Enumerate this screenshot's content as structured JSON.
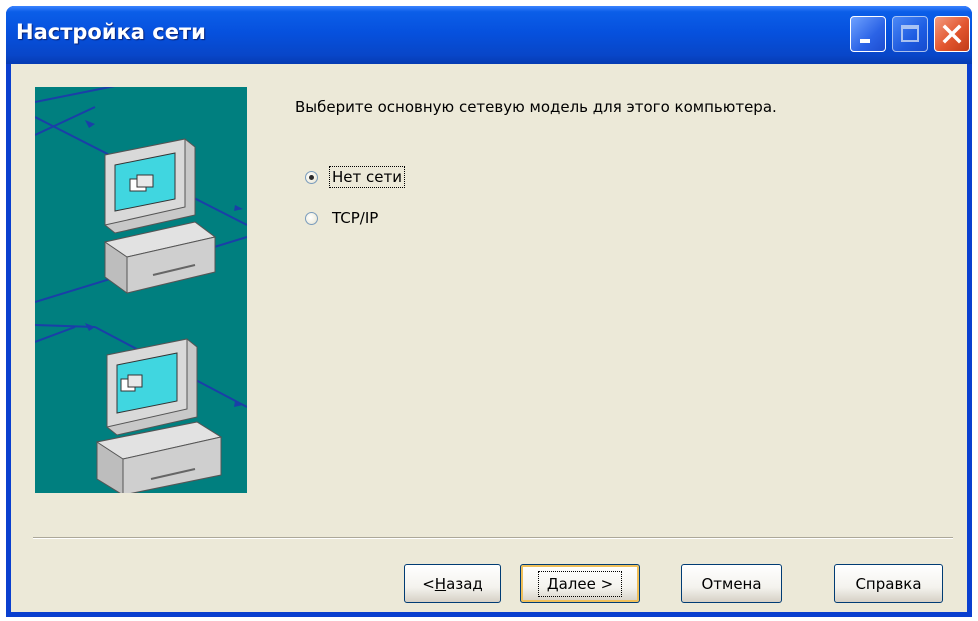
{
  "window": {
    "title": "Настройка сети",
    "colors": {
      "titlebar": "#0651de",
      "client": "#ece9d8",
      "image_bg": "#007f7f"
    }
  },
  "titlebar_buttons": {
    "minimize_icon": "minimize-icon",
    "maximize_icon": "maximize-icon",
    "close_icon": "close-icon"
  },
  "content": {
    "prompt": "Выберите основную сетевую модель для этого компьютера.",
    "options": [
      {
        "label": "Нет сети",
        "checked": true
      },
      {
        "label": "TCP/IP",
        "checked": false
      }
    ]
  },
  "buttons": {
    "back": {
      "prefix": "< ",
      "mnemonic": "Н",
      "rest": "азад"
    },
    "next": {
      "mnemonic": "Д",
      "rest": "алее >"
    },
    "cancel": "Отмена",
    "help": "Справка"
  }
}
